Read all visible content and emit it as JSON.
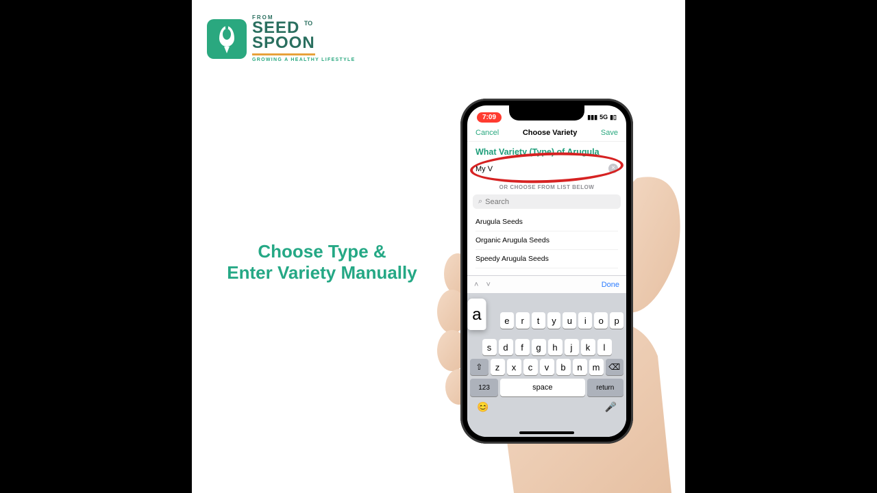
{
  "logo": {
    "from": "FROM",
    "seed": "SEED",
    "to": "TO",
    "spoon": "SPOON",
    "tagline": "GROWING A HEALTHY LIFESTYLE"
  },
  "caption": {
    "line1": "Choose Type &",
    "line2": "Enter Variety Manually"
  },
  "status": {
    "time": "7:09",
    "net": "5G",
    "battery_icon": "battery-icon"
  },
  "nav": {
    "cancel": "Cancel",
    "title": "Choose Variety",
    "save": "Save"
  },
  "section_title": "What Variety (Type) of Arugula",
  "variety_input": "My V",
  "or_choose": "OR CHOOSE FROM LIST BELOW",
  "search_placeholder": "Search",
  "list": [
    "Arugula Seeds",
    "Organic Arugula Seeds",
    "Speedy Arugula Seeds"
  ],
  "kb_accessory": {
    "done": "Done"
  },
  "keyboard": {
    "popup_key": "a",
    "row1": [
      "e",
      "r",
      "t",
      "y",
      "u",
      "i",
      "o",
      "p"
    ],
    "row2": [
      "s",
      "d",
      "f",
      "g",
      "h",
      "j",
      "k",
      "l"
    ],
    "row3": [
      "z",
      "x",
      "c",
      "v",
      "b",
      "n",
      "m"
    ],
    "shift": "⇧",
    "backspace": "⌫",
    "k123": "123",
    "space": "space",
    "return": "return",
    "emoji": "😊",
    "mic": "🎤"
  }
}
